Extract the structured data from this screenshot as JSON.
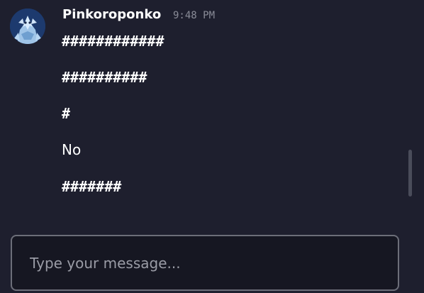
{
  "message": {
    "author": "Pinkoroponko",
    "timestamp": "9:48 PM",
    "lines": [
      "############",
      "##########",
      "#",
      "No",
      "#######"
    ]
  },
  "composer": {
    "placeholder": "Type your message..."
  },
  "colors": {
    "background": "#1e1f2e",
    "composer_background": "#161722",
    "composer_border": "#6c6e79",
    "timestamp": "#8a8c98"
  },
  "icons": {
    "avatar": "user-avatar-image"
  }
}
